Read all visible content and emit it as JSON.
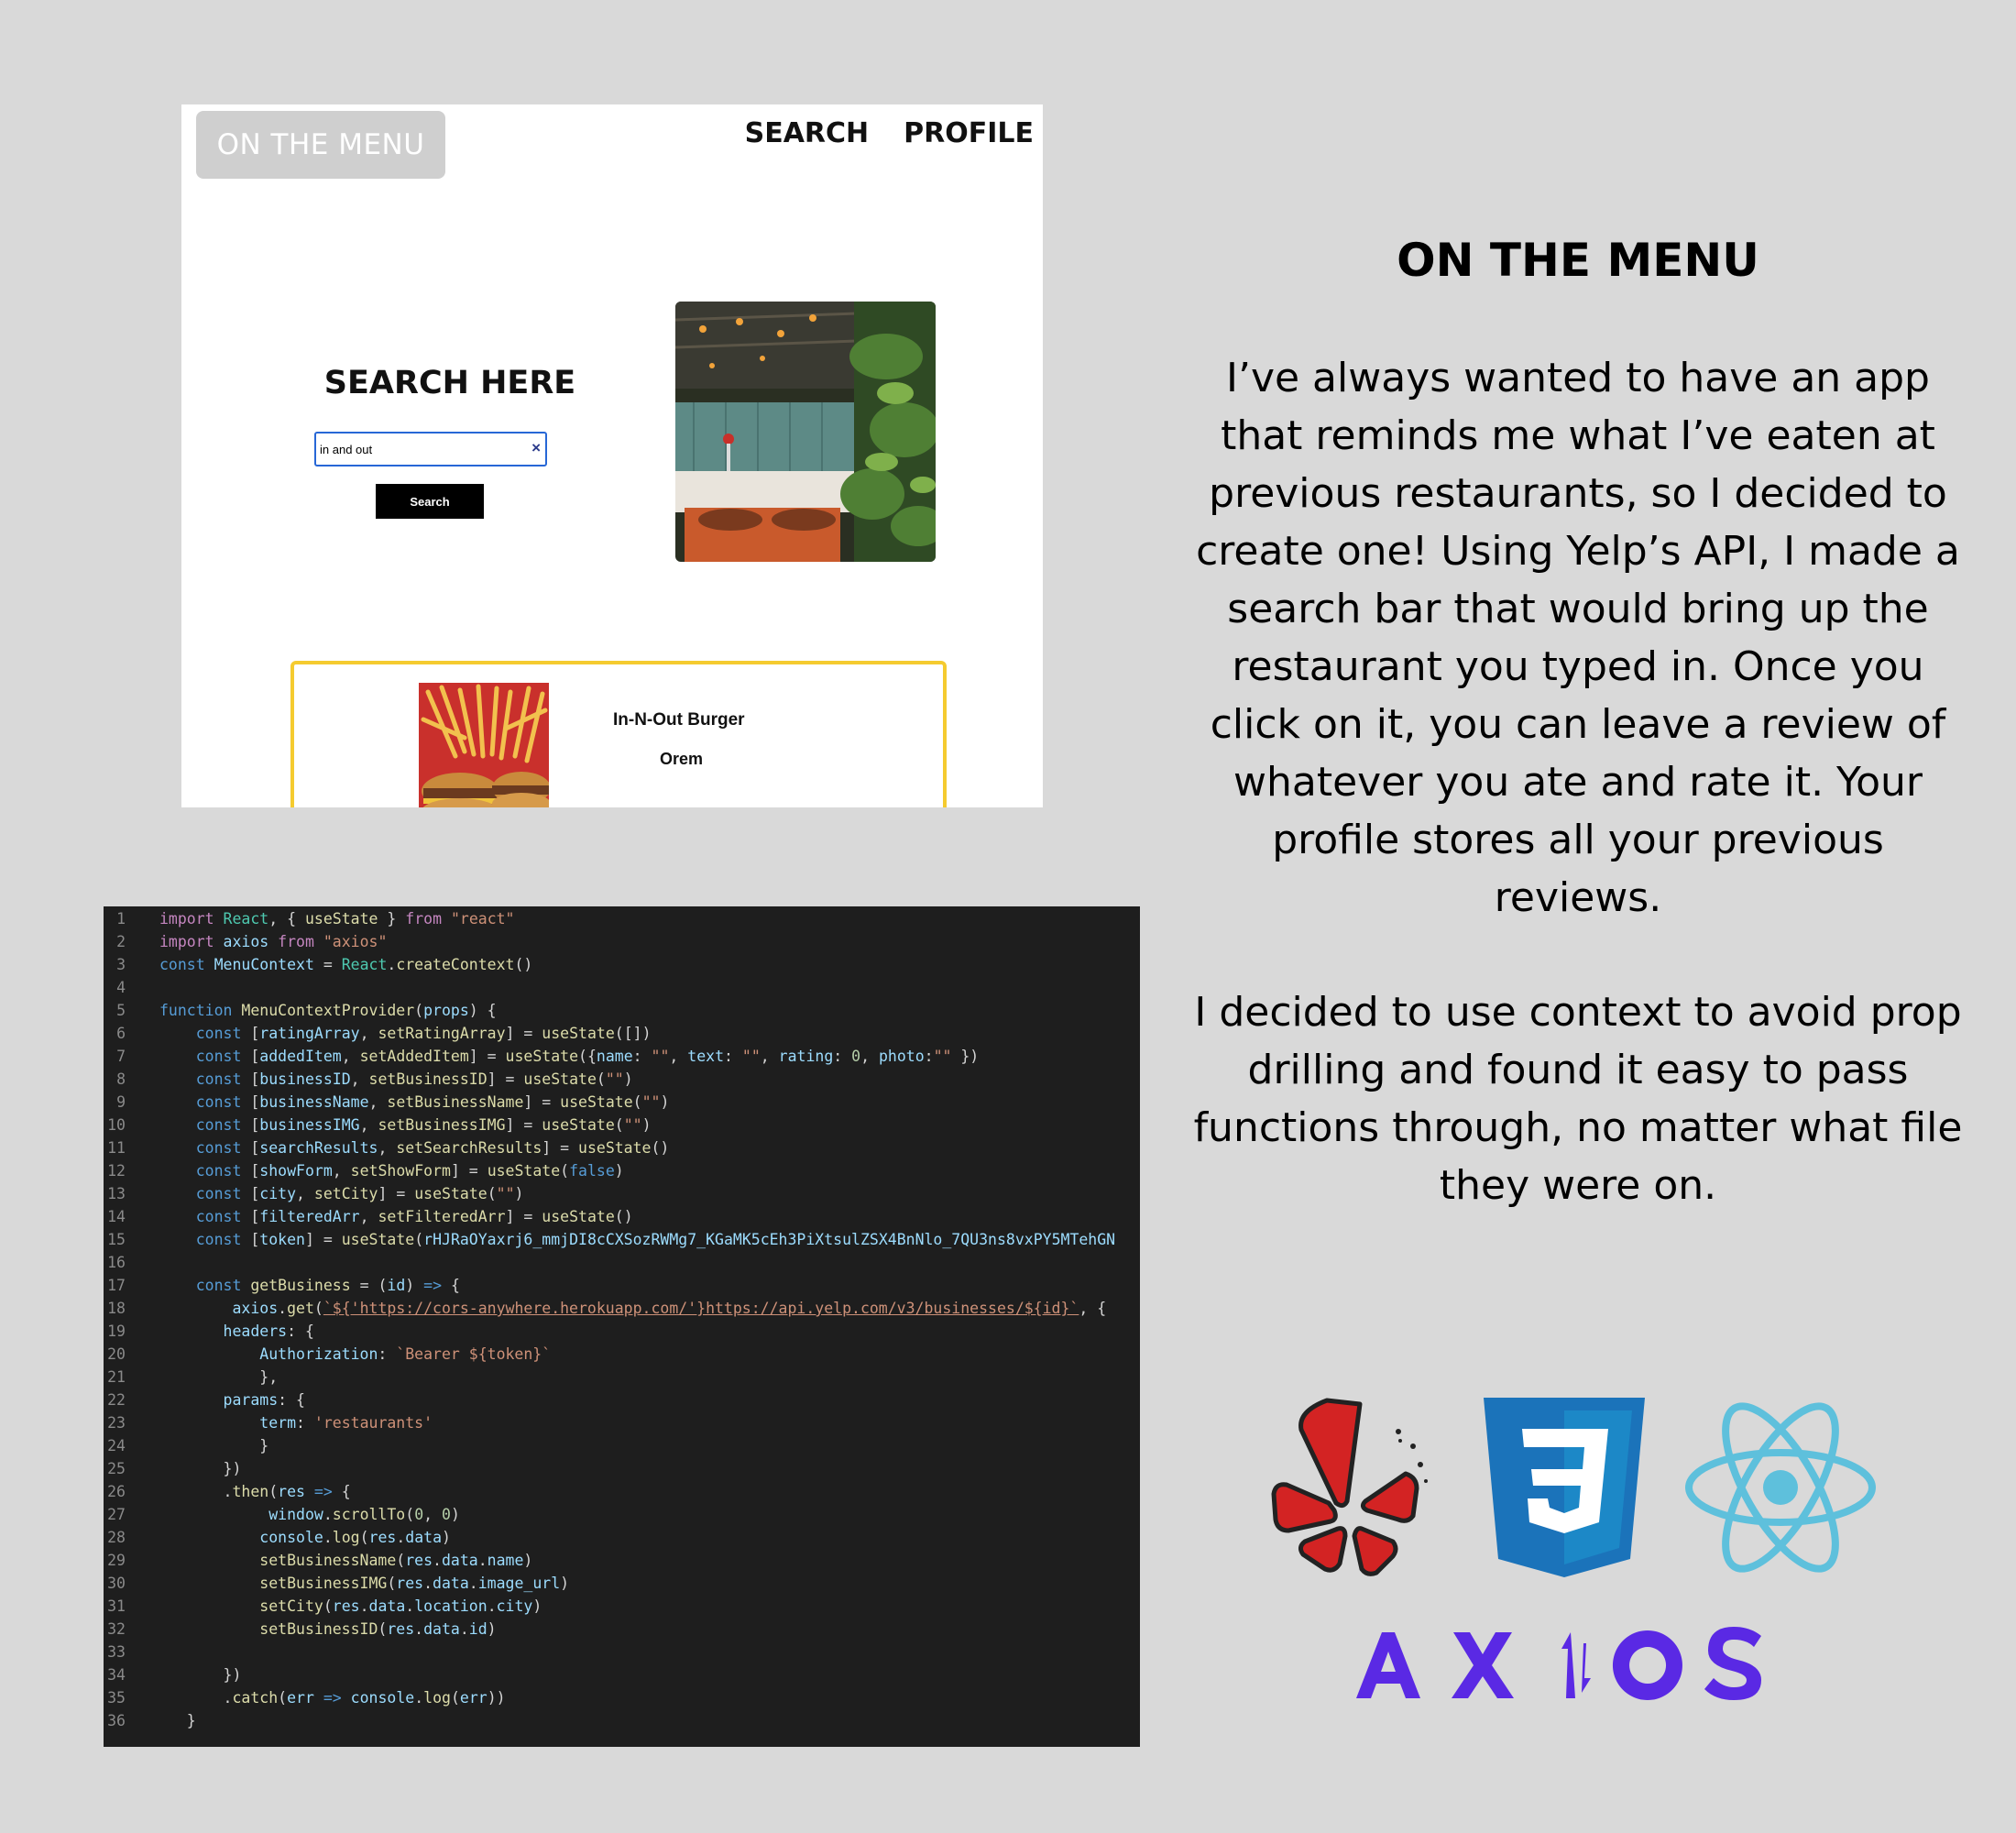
{
  "app": {
    "logo_label": "ON THE MENU",
    "nav": [
      "SEARCH",
      "PROFILE"
    ],
    "search_title": "SEARCH HERE",
    "search_value": "in and out",
    "clear_icon": "×",
    "search_button": "Search",
    "result": {
      "name": "In-N-Out Burger",
      "city": "Orem"
    }
  },
  "code_lines": [
    "import React, { useState } from \"react\"",
    "import axios from \"axios\"",
    "const MenuContext = React.createContext()",
    "",
    "function MenuContextProvider(props) {",
    "    const [ratingArray, setRatingArray] = useState([])",
    "    const [addedItem, setAddedItem] = useState({name: \"\", text: \"\", rating: 0, photo:\"\" })",
    "    const [businessID, setBusinessID] = useState(\"\")",
    "    const [businessName, setBusinessName] = useState(\"\")",
    "    const [businessIMG, setBusinessIMG] = useState(\"\")",
    "    const [searchResults, setSearchResults] = useState()",
    "    const [showForm, setShowForm] = useState(false)",
    "    const [city, setCity] = useState(\"\")",
    "    const [filteredArr, setFilteredArr] = useState()",
    "    const [token] = useState(\"rHJRaOYaxrj6_mmjDI8cCXSozRWMg7_KGaMK5cEh3PiXtsulZSX4BnNlo_7QU3ns8vxPY5MTehGN",
    "",
    "    const getBusiness = (id) => {",
    "        axios.get(`${'https://cors-anywhere.herokuapp.com/'}https://api.yelp.com/v3/businesses/${id}`, {",
    "       headers: {",
    "           Authorization: `Bearer ${token}`",
    "           },",
    "       params: {",
    "           term: 'restaurants'",
    "           }",
    "       })",
    "       .then(res => {",
    "            window.scrollTo(0, 0)",
    "           console.log(res.data)",
    "           setBusinessName(res.data.name)",
    "           setBusinessIMG(res.data.image_url)",
    "           setCity(res.data.location.city)",
    "           setBusinessID(res.data.id)",
    "",
    "       })",
    "       .catch(err => console.log(err))",
    "   }"
  ],
  "description": {
    "title": "ON THE MENU",
    "paragraph1": "I’ve always wanted to have an app that reminds me what I’ve eaten at previous restaurants, so I decided to create one! Using Yelp’s API, I made a search bar that would bring up the restaurant you typed in. Once you click on it, you can leave a review of whatever you ate and rate it. Your profile stores all your previous reviews.",
    "paragraph2": "I  decided to use context to avoid prop drilling and found it easy to pass functions through, no matter what file they were on."
  },
  "logos": {
    "icons": [
      "yelp-icon",
      "css3-icon",
      "react-icon"
    ],
    "axios_text": "AX↿OS"
  }
}
